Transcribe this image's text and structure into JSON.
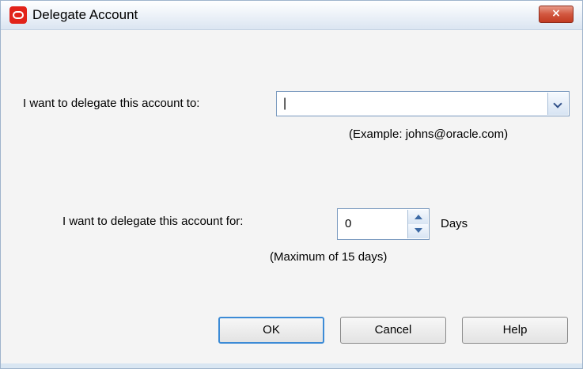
{
  "window": {
    "title": "Delegate Account",
    "close_symbol": "×",
    "app_icon": "oracle-logo-icon"
  },
  "delegate_to": {
    "label": "I want to delegate this account to:",
    "value": "|",
    "example": "(Example: johns@oracle.com)"
  },
  "delegate_for": {
    "label": "I want to delegate this account for:",
    "value": "0",
    "unit": "Days",
    "note": "(Maximum of 15 days)"
  },
  "buttons": {
    "ok": "OK",
    "cancel": "Cancel",
    "help": "Help"
  }
}
